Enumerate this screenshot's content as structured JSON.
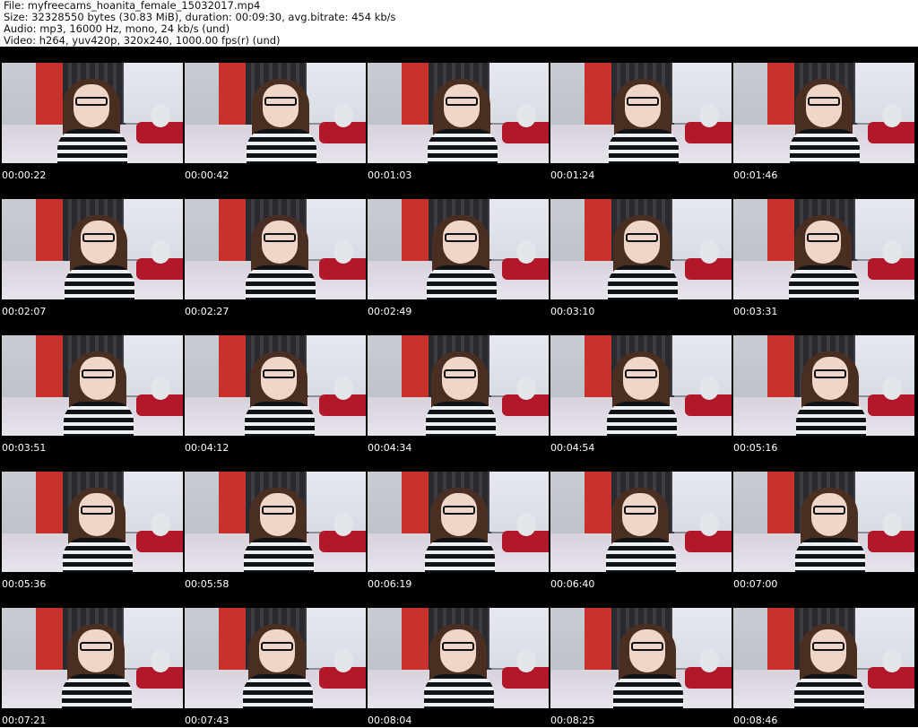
{
  "info": {
    "file": "File: myfreecams_hoanita_female_15032017.mp4",
    "size": "Size: 32328550 bytes (30.83 MiB), duration: 00:09:30, avg.bitrate: 454 kb/s",
    "audio": "Audio: mp3, 16000 Hz, mono, 24 kb/s (und)",
    "video": "Video: h264, yuv420p, 320x240, 1000.00 fps(r) (und)"
  },
  "colors": {
    "sheet_background": "#000000",
    "header_background": "#ffffff",
    "timestamp_text": "#ffffff"
  },
  "thumbnails": [
    {
      "time": "00:00:22"
    },
    {
      "time": "00:00:42"
    },
    {
      "time": "00:01:03"
    },
    {
      "time": "00:01:24"
    },
    {
      "time": "00:01:46"
    },
    {
      "time": "00:02:07"
    },
    {
      "time": "00:02:27"
    },
    {
      "time": "00:02:49"
    },
    {
      "time": "00:03:10"
    },
    {
      "time": "00:03:31"
    },
    {
      "time": "00:03:51"
    },
    {
      "time": "00:04:12"
    },
    {
      "time": "00:04:34"
    },
    {
      "time": "00:04:54"
    },
    {
      "time": "00:05:16"
    },
    {
      "time": "00:05:36"
    },
    {
      "time": "00:05:58"
    },
    {
      "time": "00:06:19"
    },
    {
      "time": "00:06:40"
    },
    {
      "time": "00:07:00"
    },
    {
      "time": "00:07:21"
    },
    {
      "time": "00:07:43"
    },
    {
      "time": "00:08:04"
    },
    {
      "time": "00:08:25"
    },
    {
      "time": "00:08:46"
    }
  ]
}
